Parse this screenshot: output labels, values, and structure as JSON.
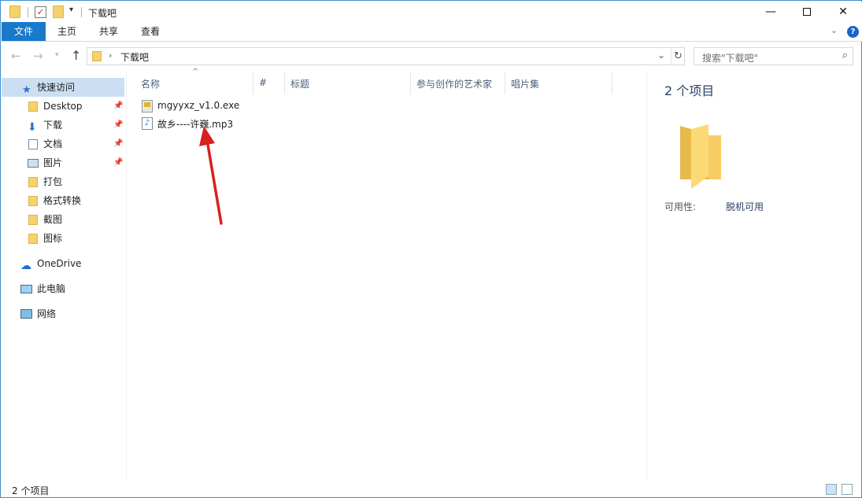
{
  "window": {
    "title": "下载吧",
    "controls": {
      "minimize": "—",
      "maximize": "",
      "close": "✕"
    }
  },
  "ribbon": {
    "tabs": [
      {
        "label": "文件"
      },
      {
        "label": "主页"
      },
      {
        "label": "共享"
      },
      {
        "label": "查看"
      }
    ],
    "help": "?"
  },
  "address": {
    "path_sep": "›",
    "path": "下载吧",
    "refresh_icon": "↻",
    "search_placeholder": "搜索\"下载吧\""
  },
  "sidebar": {
    "items": [
      {
        "label": "快速访问",
        "icon": "star-icon"
      },
      {
        "label": "Desktop",
        "icon": "folder-icon",
        "pinned": true
      },
      {
        "label": "下载",
        "icon": "download-icon",
        "pinned": true
      },
      {
        "label": "文档",
        "icon": "document-icon",
        "pinned": true
      },
      {
        "label": "图片",
        "icon": "pictures-icon",
        "pinned": true
      },
      {
        "label": "打包",
        "icon": "folder-icon"
      },
      {
        "label": "格式转换",
        "icon": "folder-icon"
      },
      {
        "label": "截图",
        "icon": "folder-icon"
      },
      {
        "label": "图标",
        "icon": "folder-icon"
      },
      {
        "label": "OneDrive",
        "icon": "cloud-icon"
      },
      {
        "label": "此电脑",
        "icon": "computer-icon"
      },
      {
        "label": "网络",
        "icon": "network-icon"
      }
    ]
  },
  "list": {
    "columns": [
      "名称",
      "#",
      "标题",
      "参与创作的艺术家",
      "唱片集"
    ],
    "files": [
      {
        "name": "mgyyxz_v1.0.exe",
        "icon": "exe-icon"
      },
      {
        "name": "故乡----许巍.mp3",
        "icon": "audio-file-icon"
      }
    ]
  },
  "details": {
    "count": "2 个项目",
    "availability_label": "可用性:",
    "availability_value": "脱机可用"
  },
  "status": {
    "text": "2 个项目"
  },
  "colors": {
    "accent": "#1979ca",
    "selection": "#ccdef2",
    "folder": "#f6d26b",
    "annotation_arrow": "#d8201f"
  }
}
